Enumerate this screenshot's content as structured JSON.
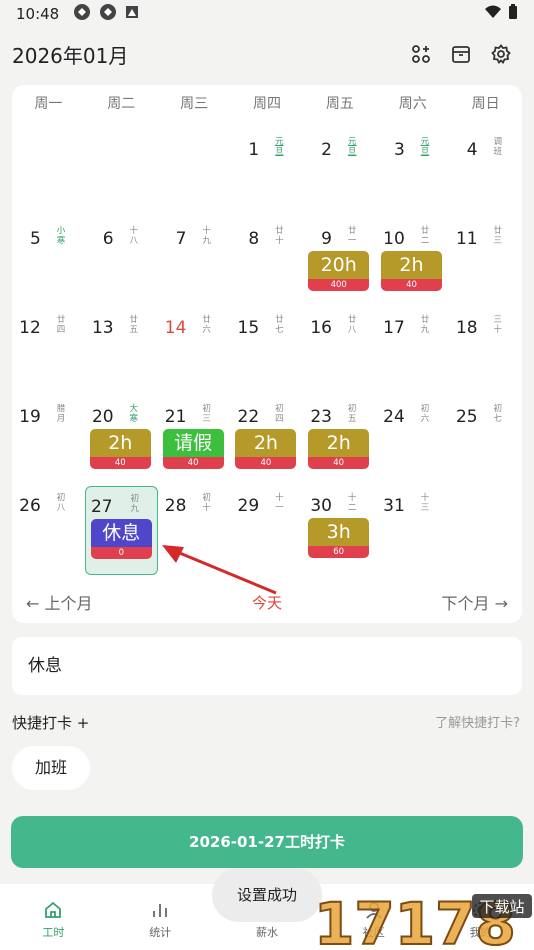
{
  "status_bar": {
    "time": "10:48"
  },
  "header": {
    "title": "2026年01月"
  },
  "weekdays": [
    "周一",
    "周二",
    "周三",
    "周四",
    "周五",
    "周六",
    "周日"
  ],
  "calendar_rows": [
    [
      null,
      null,
      null,
      {
        "day": "1",
        "lunar": "元旦",
        "style": "green"
      },
      {
        "day": "2",
        "lunar": "元旦",
        "style": "green"
      },
      {
        "day": "3",
        "lunar": "元旦",
        "style": "green"
      },
      {
        "day": "4",
        "lunar": "调班",
        "style": "work"
      }
    ],
    [
      {
        "day": "5",
        "lunar": "小寒",
        "style": "holiday"
      },
      {
        "day": "6",
        "lunar": "十八"
      },
      {
        "day": "7",
        "lunar": "十九"
      },
      {
        "day": "8",
        "lunar": "廿十"
      },
      {
        "day": "9",
        "lunar": "廿一",
        "badge": {
          "type": "ot",
          "main": "20h",
          "sub": "400"
        }
      },
      {
        "day": "10",
        "lunar": "廿二",
        "badge": {
          "type": "ot",
          "main": "2h",
          "sub": "40"
        }
      },
      {
        "day": "11",
        "lunar": "廿三"
      }
    ],
    [
      {
        "day": "12",
        "lunar": "廿四"
      },
      {
        "day": "13",
        "lunar": "廿五"
      },
      {
        "day": "14",
        "lunar": "廿六",
        "today": true
      },
      {
        "day": "15",
        "lunar": "廿七"
      },
      {
        "day": "16",
        "lunar": "廿八"
      },
      {
        "day": "17",
        "lunar": "廿九"
      },
      {
        "day": "18",
        "lunar": "三十"
      }
    ],
    [
      {
        "day": "19",
        "lunar": "腊月"
      },
      {
        "day": "20",
        "lunar": "大寒",
        "style": "holiday",
        "badge": {
          "type": "ot",
          "main": "2h",
          "sub": "40"
        }
      },
      {
        "day": "21",
        "lunar": "初三",
        "badge": {
          "type": "leave",
          "main": "请假",
          "sub": "40"
        }
      },
      {
        "day": "22",
        "lunar": "初四",
        "badge": {
          "type": "ot",
          "main": "2h",
          "sub": "40"
        }
      },
      {
        "day": "23",
        "lunar": "初五",
        "badge": {
          "type": "ot",
          "main": "2h",
          "sub": "40"
        }
      },
      {
        "day": "24",
        "lunar": "初六"
      },
      {
        "day": "25",
        "lunar": "初七"
      }
    ],
    [
      {
        "day": "26",
        "lunar": "初八"
      },
      {
        "day": "27",
        "lunar": "初九",
        "selected": true,
        "badge": {
          "type": "rest",
          "main": "休息",
          "sub": "0"
        }
      },
      {
        "day": "28",
        "lunar": "初十"
      },
      {
        "day": "29",
        "lunar": "十一"
      },
      {
        "day": "30",
        "lunar": "十二",
        "badge": {
          "type": "ot",
          "main": "3h",
          "sub": "60"
        }
      },
      {
        "day": "31",
        "lunar": "十三"
      },
      null
    ]
  ],
  "cal_nav": {
    "prev": "上个月",
    "today": "今天",
    "next": "下个月"
  },
  "note": "休息",
  "quick": {
    "label": "快捷打卡 +",
    "help": "了解快捷打卡?",
    "chip": "加班"
  },
  "clock_button": "2026-01-27工时打卡",
  "toast": "设置成功",
  "bottom_nav": [
    {
      "label": "工时",
      "icon": "home-icon",
      "active": true
    },
    {
      "label": "统计",
      "icon": "bar-chart-icon"
    },
    {
      "label": "薪水",
      "icon": "salary-icon"
    },
    {
      "label": "社区",
      "icon": "community-icon"
    },
    {
      "label": "我的",
      "icon": "settings-icon"
    }
  ],
  "watermark": "17178 下载站",
  "colors": {
    "accent": "#45b78c",
    "overtime": "#b59a2a",
    "leave": "#3cbf3c",
    "rest": "#4f46c9",
    "today": "#e0483c"
  }
}
